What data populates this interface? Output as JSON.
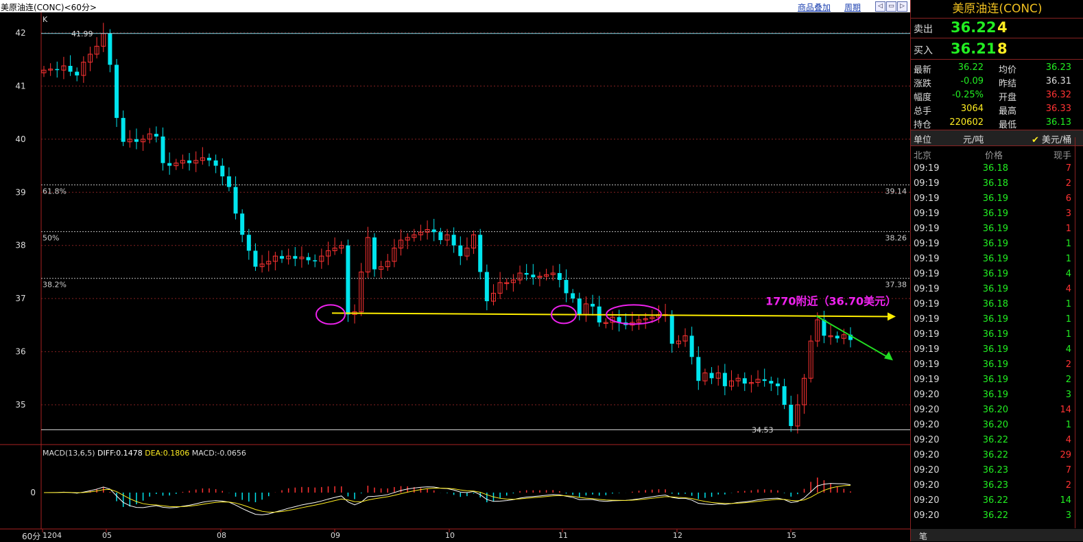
{
  "window": {
    "title": "美原油连(CONC)<60分>",
    "overlay_link": "商品叠加",
    "period_link": "周期",
    "nav_buttons": [
      "◁",
      "▭",
      "▷",
      "✕"
    ]
  },
  "chart": {
    "kline_label": "K",
    "y_ticks": [
      "42",
      "41",
      "40",
      "39",
      "38",
      "37",
      "36",
      "35"
    ],
    "x_ticks": [
      "1204",
      "05",
      "08",
      "09",
      "10",
      "11",
      "12",
      "15"
    ],
    "period_label": "60分",
    "high_label": "41.99",
    "low_label": "34.53",
    "fib_levels": [
      {
        "label": "61.8%",
        "value_label": "39.14"
      },
      {
        "label": "50%",
        "value_label": "38.26"
      },
      {
        "label": "38.2%",
        "value_label": "37.38"
      }
    ],
    "annotation": "1770附近（36.70美元）",
    "macd_header": {
      "name": "MACD(13,6,5)",
      "diff": "DIFF:0.1478",
      "dea": "DEA:0.1806",
      "macd": "MACD:-0.0656"
    },
    "macd_zero": "0",
    "colors": {
      "up": "#ff3333",
      "down": "#00e5ee",
      "annotation": "#ee22ee",
      "support_line": "#ffee00",
      "arrow": "#22dd22"
    }
  },
  "chart_data": {
    "type": "candlestick",
    "price_range": [
      34.5,
      42.3
    ],
    "level_high": 41.99,
    "level_low": 34.53,
    "support": 36.7,
    "closes": [
      41.3,
      41.32,
      41.3,
      41.38,
      41.27,
      41.2,
      41.45,
      41.6,
      41.75,
      41.99,
      41.4,
      40.4,
      39.95,
      40.0,
      39.95,
      40.0,
      40.1,
      40.05,
      39.55,
      39.5,
      39.55,
      39.6,
      39.55,
      39.6,
      39.65,
      39.6,
      39.5,
      39.3,
      39.1,
      38.6,
      38.2,
      37.9,
      37.6,
      37.65,
      37.7,
      37.8,
      37.75,
      37.8,
      37.75,
      37.78,
      37.72,
      37.7,
      37.8,
      37.9,
      37.95,
      38.0,
      36.7,
      36.75,
      37.5,
      38.15,
      37.55,
      37.6,
      37.7,
      37.95,
      38.1,
      38.15,
      38.2,
      38.25,
      38.3,
      38.25,
      38.1,
      38.2,
      38.0,
      37.8,
      37.95,
      38.2,
      37.5,
      36.95,
      37.1,
      37.3,
      37.3,
      37.35,
      37.48,
      37.45,
      37.4,
      37.42,
      37.45,
      37.48,
      37.35,
      37.1,
      37.0,
      36.7,
      36.9,
      36.85,
      36.55,
      36.55,
      36.65,
      36.55,
      36.5,
      36.55,
      36.6,
      36.62,
      36.65,
      36.7,
      36.7,
      36.15,
      36.2,
      36.3,
      35.9,
      35.45,
      35.6,
      35.5,
      35.6,
      35.35,
      35.45,
      35.5,
      35.4,
      35.42,
      35.48,
      35.45,
      35.4,
      35.35,
      35.0,
      34.6,
      35.0,
      35.5,
      36.2,
      36.6,
      36.3,
      36.3,
      36.25,
      36.32,
      36.22
    ],
    "macd_diff": "0.1478",
    "macd_dea": "0.1806",
    "macd_value": "-0.0656"
  },
  "panel": {
    "title": "美原油连(CONC)",
    "ask": {
      "label": "卖出",
      "price": "36.22",
      "volume": "4"
    },
    "bid": {
      "label": "买入",
      "price": "36.21",
      "volume": "8"
    },
    "stats": [
      {
        "l1": "最新",
        "v1": "36.22",
        "c1": "g",
        "l2": "均价",
        "v2": "36.23",
        "c2": "g"
      },
      {
        "l1": "涨跌",
        "v1": "-0.09",
        "c1": "g",
        "l2": "昨结",
        "v2": "36.31",
        "c2": "w"
      },
      {
        "l1": "幅度",
        "v1": "-0.25%",
        "c1": "g",
        "l2": "开盘",
        "v2": "36.32",
        "c2": "r"
      },
      {
        "l1": "总手",
        "v1": "3064",
        "c1": "y",
        "l2": "最高",
        "v2": "36.33",
        "c2": "r"
      },
      {
        "l1": "持仓",
        "v1": "220602",
        "c1": "y",
        "l2": "最低",
        "v2": "36.13",
        "c2": "g"
      }
    ],
    "unit": {
      "label": "单位",
      "opt1": "元/吨",
      "opt2": "美元/桶"
    },
    "ticks_header": {
      "time": "北京",
      "price": "价格",
      "vol": "现手"
    },
    "ticks": [
      {
        "time": "09:19",
        "price": "36.18",
        "vol": "7",
        "dir": "r"
      },
      {
        "time": "09:19",
        "price": "36.18",
        "vol": "2",
        "dir": "r"
      },
      {
        "time": "09:19",
        "price": "36.19",
        "vol": "6",
        "dir": "r"
      },
      {
        "time": "09:19",
        "price": "36.19",
        "vol": "3",
        "dir": "r"
      },
      {
        "time": "09:19",
        "price": "36.19",
        "vol": "1",
        "dir": "r"
      },
      {
        "time": "09:19",
        "price": "36.19",
        "vol": "1",
        "dir": "g"
      },
      {
        "time": "09:19",
        "price": "36.19",
        "vol": "1",
        "dir": "g"
      },
      {
        "time": "09:19",
        "price": "36.19",
        "vol": "4",
        "dir": "g"
      },
      {
        "time": "09:19",
        "price": "36.19",
        "vol": "4",
        "dir": "r"
      },
      {
        "time": "09:19",
        "price": "36.18",
        "vol": "1",
        "dir": "g"
      },
      {
        "time": "09:19",
        "price": "36.19",
        "vol": "1",
        "dir": "g"
      },
      {
        "time": "09:19",
        "price": "36.19",
        "vol": "1",
        "dir": "g"
      },
      {
        "time": "09:19",
        "price": "36.19",
        "vol": "4",
        "dir": "g"
      },
      {
        "time": "09:19",
        "price": "36.19",
        "vol": "2",
        "dir": "r"
      },
      {
        "time": "09:19",
        "price": "36.19",
        "vol": "2",
        "dir": "g"
      },
      {
        "time": "09:20",
        "price": "36.19",
        "vol": "3",
        "dir": "g"
      },
      {
        "time": "09:20",
        "price": "36.20",
        "vol": "14",
        "dir": "r"
      },
      {
        "time": "09:20",
        "price": "36.20",
        "vol": "1",
        "dir": "g"
      },
      {
        "time": "09:20",
        "price": "36.22",
        "vol": "4",
        "dir": "r"
      },
      {
        "time": "09:20",
        "price": "36.22",
        "vol": "29",
        "dir": "r"
      },
      {
        "time": "09:20",
        "price": "36.23",
        "vol": "7",
        "dir": "r"
      },
      {
        "time": "09:20",
        "price": "36.23",
        "vol": "2",
        "dir": "r"
      },
      {
        "time": "09:20",
        "price": "36.22",
        "vol": "14",
        "dir": "g"
      },
      {
        "time": "09:20",
        "price": "36.22",
        "vol": "3",
        "dir": "g"
      }
    ],
    "bottom_tab": "笔"
  }
}
